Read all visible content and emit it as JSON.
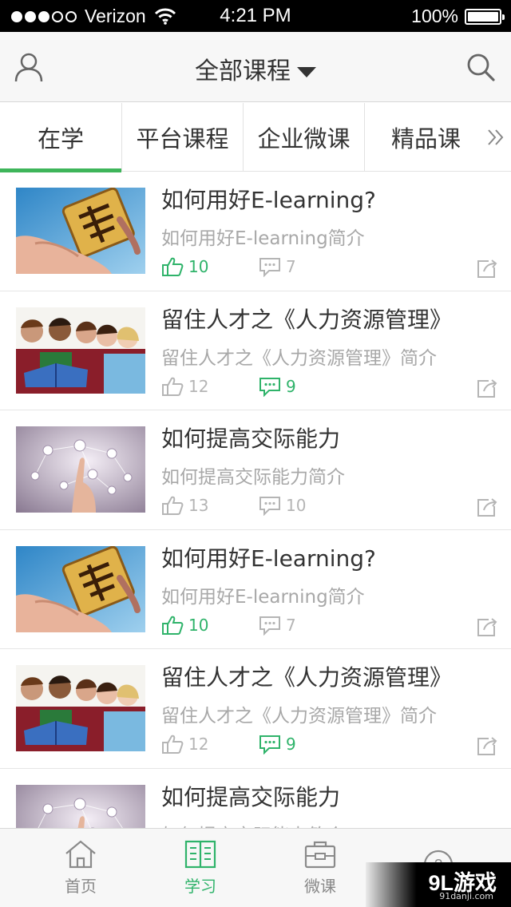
{
  "status_bar": {
    "carrier": "Verizon",
    "time": "4:21 PM",
    "battery": "100%",
    "signal_bars": 3
  },
  "header": {
    "title": "全部课程",
    "user_icon": "user-icon",
    "search_icon": "search-icon"
  },
  "tabs": [
    {
      "label": "在学",
      "active": true
    },
    {
      "label": "平台课程",
      "active": false
    },
    {
      "label": "企业微课",
      "active": false
    },
    {
      "label": "精品课",
      "active": false
    }
  ],
  "courses": [
    {
      "title": "如何用好E-learning?",
      "description": "如何用好E-learning简介",
      "likes": "10",
      "comments": "7",
      "liked": true,
      "commented": false,
      "thumbnail": "chess-piece"
    },
    {
      "title": "留住人才之《人力资源管理》",
      "description": "留住人才之《人力资源管理》简介",
      "likes": "12",
      "comments": "9",
      "liked": false,
      "commented": true,
      "thumbnail": "students"
    },
    {
      "title": "如何提高交际能力",
      "description": "如何提高交际能力简介",
      "likes": "13",
      "comments": "10",
      "liked": false,
      "commented": false,
      "thumbnail": "network"
    },
    {
      "title": "如何用好E-learning?",
      "description": "如何用好E-learning简介",
      "likes": "10",
      "comments": "7",
      "liked": true,
      "commented": false,
      "thumbnail": "chess-piece"
    },
    {
      "title": "留住人才之《人力资源管理》",
      "description": "留住人才之《人力资源管理》简介",
      "likes": "12",
      "comments": "9",
      "liked": false,
      "commented": true,
      "thumbnail": "students"
    },
    {
      "title": "如何提高交际能力",
      "description": "如何提高交际能力简介",
      "likes": "",
      "comments": "",
      "liked": false,
      "commented": false,
      "thumbnail": "network"
    }
  ],
  "bottom_nav": [
    {
      "label": "首页",
      "icon": "home-icon",
      "active": false
    },
    {
      "label": "学习",
      "icon": "book-icon",
      "active": true
    },
    {
      "label": "微课",
      "icon": "briefcase-icon",
      "active": false
    }
  ],
  "watermark": {
    "main": "9L游戏",
    "sub": "91danji.com"
  },
  "colors": {
    "accent": "#2fb36a",
    "tab_indicator": "#3eb55a",
    "muted": "#a8a8a8"
  }
}
